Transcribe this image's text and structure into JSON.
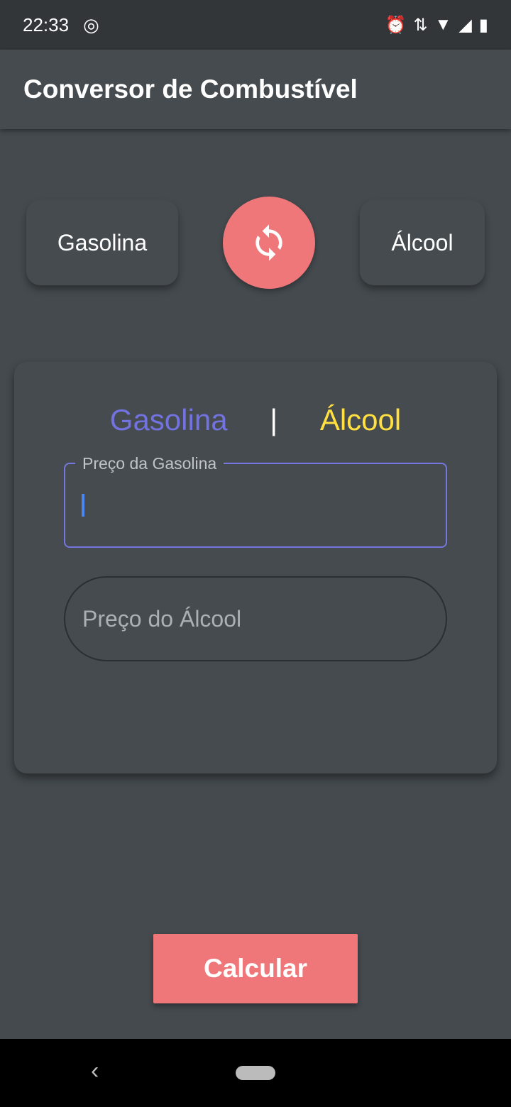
{
  "status_bar": {
    "time": "22:33"
  },
  "app_bar": {
    "title": "Conversor de Combustível"
  },
  "selector": {
    "left": "Gasolina",
    "right": "Álcool"
  },
  "card": {
    "tab_left": "Gasolina",
    "separator": "|",
    "tab_right": "Álcool",
    "field_gasoline_label": "Preço da Gasolina",
    "field_gasoline_value": "",
    "field_alcohol_placeholder": "Preço do Álcool"
  },
  "calculate_label": "Calcular",
  "colors": {
    "accent": "#f07779",
    "purple": "#7272e0",
    "yellow": "#ffe040"
  }
}
